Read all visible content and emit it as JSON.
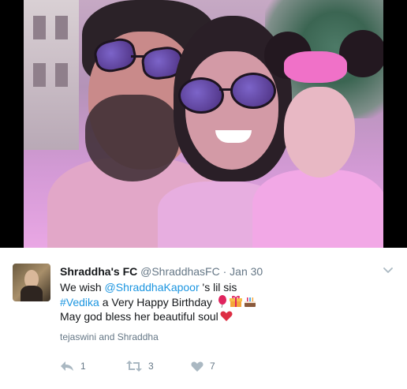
{
  "tweet": {
    "display_name": "Shraddha's FC",
    "handle": "@ShraddhasFC",
    "separator": "·",
    "date": "Jan 30",
    "text_line1_prefix": "We wish ",
    "text_line1_mention": "@ShraddhaKapoor",
    "text_line1_suffix": " 's lil sis",
    "text_line2_hashtag": "#Vedika",
    "text_line2_suffix": " a Very Happy Birthday",
    "text_line3": "May god bless her beautiful soul",
    "emojis_line2": [
      "balloon-icon",
      "gift-icon",
      "cake-icon"
    ],
    "emoji_line3": "red-heart-icon",
    "likers_text": "tejaswini and Shraddha",
    "reply_count": "1",
    "retweet_count": "3",
    "like_count": "7"
  },
  "colors": {
    "link": "#1b95e0",
    "text": "#14171a",
    "meta": "#657786",
    "action_icon": "#aab8c2"
  }
}
